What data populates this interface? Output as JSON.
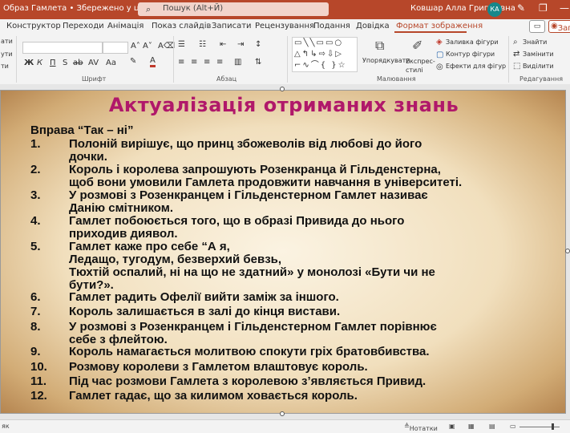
{
  "titlebar": {
    "document_title": "Образ Гамлета • Збережено у цей ПК ∨",
    "search_placeholder": "Пошук (Alt+Й)",
    "user_name": "Ковшар Алла Григорівна",
    "user_initials": "КА"
  },
  "ribbon_tabs": {
    "items": [
      "Конструктор",
      "Переходи",
      "Анімація",
      "Показ слайдів",
      "Записати",
      "Рецензування",
      "Подання",
      "Довідка",
      "Формат зображення"
    ],
    "present_label": "Зап"
  },
  "ribbon": {
    "left_partial": [
      "ати",
      "ути",
      "ти"
    ],
    "groups": {
      "font": "Шрифт",
      "paragraph": "Абзац",
      "drawing": "Малювання",
      "editing": "Редагування"
    },
    "font_buttons": [
      "Ж",
      "К",
      "П",
      "S",
      "ab",
      "AV",
      "Aa"
    ],
    "arrange_label": "Упорядкувати",
    "quick_styles_label": "Експрес-стилі",
    "shape_fill_label": "Заливка фігури",
    "shape_outline_label": "Контур фігури",
    "shape_effects_label": "Ефекти для фігур",
    "find_label": "Знайти",
    "replace_label": "Замінити",
    "select_label": "Виділити"
  },
  "slide": {
    "title": "Актуалізація отриманих знань",
    "exercise_title": "Вправа “Так – ні”",
    "items": [
      {
        "num": "1.",
        "text": "Полоній вирішує, що принц збожеволів від любові до його\nдочки."
      },
      {
        "num": "2.",
        "text": "Король і королева запрошують Розенкранца й Гільденстерна,\nщоб вони умовили Гамлета продовжити навчання в університеті."
      },
      {
        "num": "3.",
        "text": "У розмові з Розенкранцем і Гільденстерном Гамлет називає\nДанію смітником."
      },
      {
        "num": "4.",
        "text": "Гамлет побоюється того, що в образі Привида до нього\nприходив диявол."
      },
      {
        "num": "5.",
        "text": "Гамлет каже про себе   “А я,\nЛедащо, тугодум, безверхий бевзь,\nТюхтій оспалий, ні на що не здатний» у монолозі «Бути чи не\nбути?»."
      },
      {
        "num": "6.",
        "text": "Гамлет радить Офелії вийти заміж за іншого."
      },
      {
        "num": "7.",
        "text": "Король залишається в залі до кінця вистави."
      },
      {
        "num": "8.",
        "text": "У розмові з Розенкранцем і Гільденстерном Гамлет порівнює\nсебе з флейтою."
      },
      {
        "num": "9.",
        "text": "Король намагається молитвою спокути гріх братовбивства."
      },
      {
        "num": "10.",
        "text": "Розмову королеви з Гамлетом влаштовує король."
      },
      {
        "num": "11.",
        "text": "Під час розмови Гамлета з королевою з’являється  Привид."
      },
      {
        "num": "12.",
        "text": "Гамлет гадає, що за килимом ховається король."
      }
    ]
  },
  "statusbar": {
    "left_text": "як",
    "notes_label": "Нотатки"
  }
}
